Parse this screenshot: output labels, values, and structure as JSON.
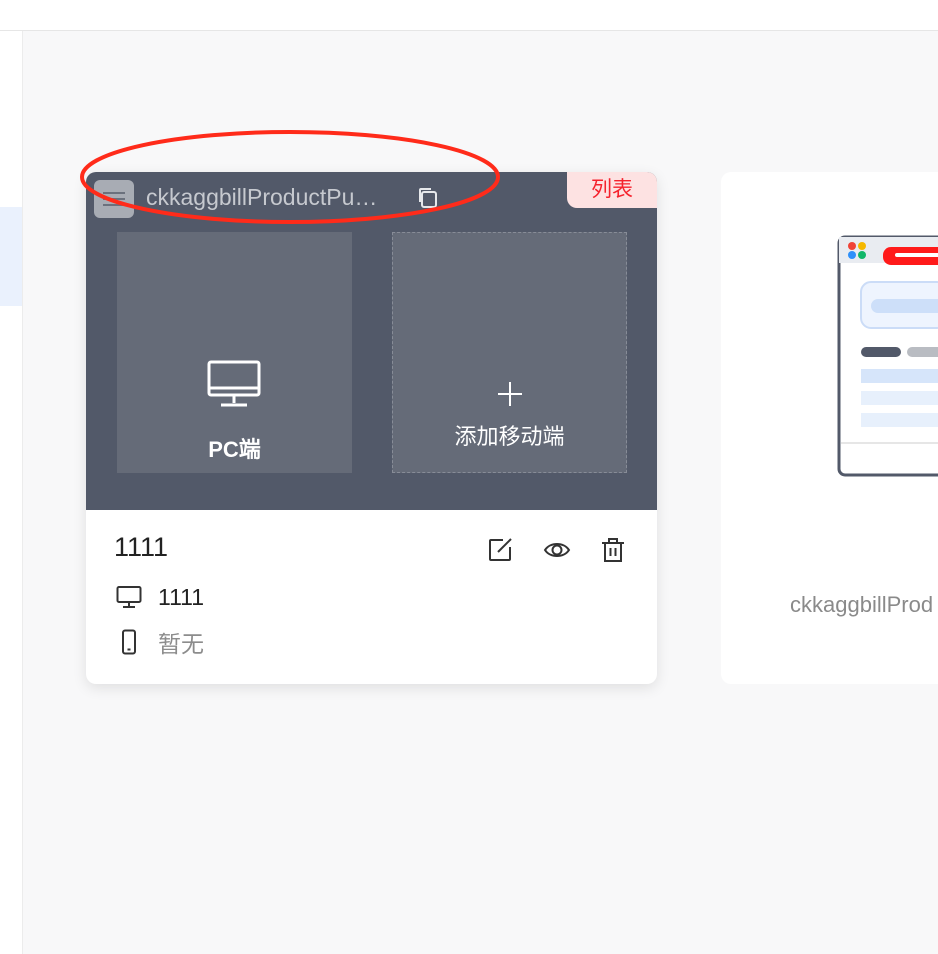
{
  "card": {
    "name": "ckkaggbillProductPu…",
    "badge": "列表",
    "tiles": {
      "pc_label": "PC端",
      "add_mobile_label": "添加移动端"
    },
    "title": "1111",
    "pc_value": "1111",
    "mobile_value": "暂无"
  },
  "card2": {
    "name": "ckkaggbillProd"
  },
  "colors": {
    "card_header_bg": "#525969",
    "tile_bg": "#656b78",
    "badge_bg": "#fde2e2",
    "badge_text": "#f5222d",
    "annotation": "#ff2b1a"
  },
  "icons": [
    "menu-icon",
    "copy-icon",
    "monitor-icon",
    "plus-icon",
    "edit-icon",
    "eye-icon",
    "trash-icon",
    "phone-icon"
  ]
}
